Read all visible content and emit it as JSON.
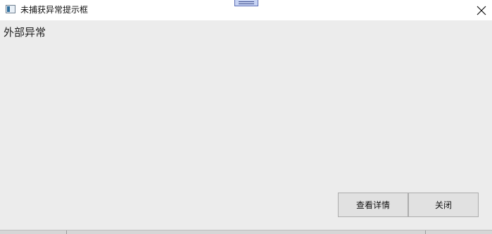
{
  "window": {
    "title": "未捕获异常提示框",
    "icon": "window-app-icon"
  },
  "titlebar": {
    "close_icon": "close-icon"
  },
  "main": {
    "message": "外部异常"
  },
  "buttons": {
    "details_label": "查看详情",
    "close_label": "关闭"
  }
}
